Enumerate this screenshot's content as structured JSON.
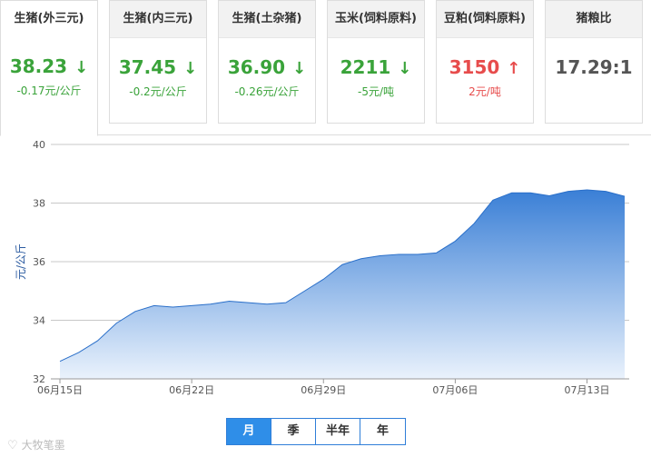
{
  "cards": [
    {
      "title": "生猪(外三元)",
      "value": "38.23",
      "arrow": "↓",
      "change": "-0.17元/公斤",
      "trend": "down"
    },
    {
      "title": "生猪(内三元)",
      "value": "37.45",
      "arrow": "↓",
      "change": "-0.2元/公斤",
      "trend": "down"
    },
    {
      "title": "生猪(土杂猪)",
      "value": "36.90",
      "arrow": "↓",
      "change": "-0.26元/公斤",
      "trend": "down"
    },
    {
      "title": "玉米(饲料原料)",
      "value": "2211",
      "arrow": "↓",
      "change": "-5元/吨",
      "trend": "down"
    },
    {
      "title": "豆粕(饲料原料)",
      "value": "3150",
      "arrow": "↑",
      "change": "2元/吨",
      "trend": "up"
    },
    {
      "title": "猪粮比",
      "value": "17.29:1",
      "arrow": "",
      "change": "",
      "trend": "neutral"
    }
  ],
  "colors": {
    "down": "#3aa33a",
    "up": "#e74c4c",
    "accent": "#2f8ee8",
    "area_top": "#3a7fd6"
  },
  "period_buttons": [
    "月",
    "季",
    "半年",
    "年"
  ],
  "selected_period": "月",
  "watermark": "大牧笔墨",
  "chart_data": {
    "type": "area",
    "title": "",
    "xlabel": "",
    "ylabel": "元/公斤",
    "ylim": [
      32,
      40
    ],
    "yticks": [
      32,
      34,
      36,
      38,
      40
    ],
    "x_tick_labels": [
      "06月15日",
      "06月22日",
      "06月29日",
      "07月06日",
      "07月13日"
    ],
    "x_tick_index": [
      0,
      7,
      14,
      21,
      28
    ],
    "grid": true,
    "series": [
      {
        "values": [
          32.6,
          32.9,
          33.3,
          33.9,
          34.3,
          34.5,
          34.45,
          34.5,
          34.55,
          34.65,
          34.6,
          34.55,
          34.6,
          35.0,
          35.4,
          35.9,
          36.1,
          36.2,
          36.25,
          36.25,
          36.3,
          36.7,
          37.3,
          38.1,
          38.35,
          38.35,
          38.25,
          38.4,
          38.45,
          38.4,
          38.23
        ]
      }
    ]
  }
}
